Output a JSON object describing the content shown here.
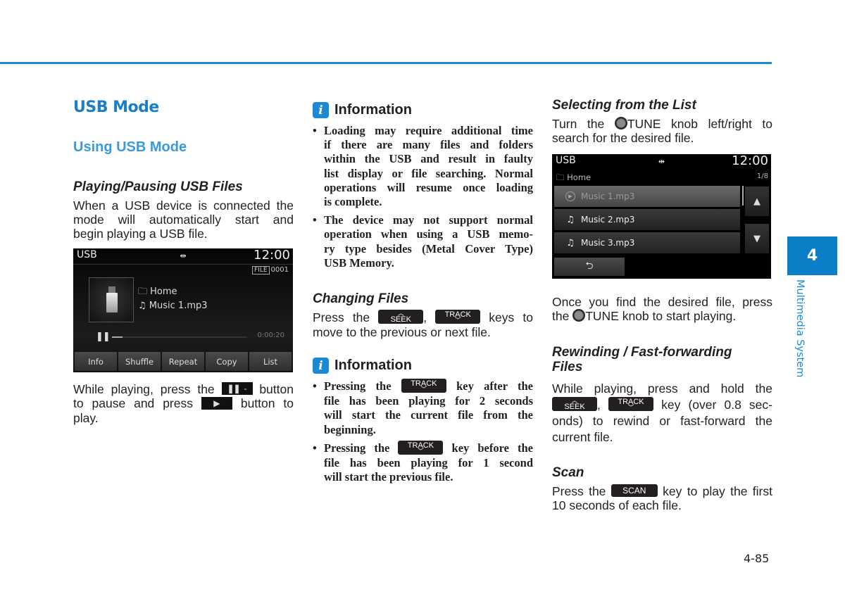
{
  "page": {
    "chapter_number": "4",
    "chapter_title": "Multimedia System",
    "page_number": "4-85",
    "accent_color": "#1a8ad4"
  },
  "col1": {
    "section_title": "USB Mode",
    "subsection_title": "Using USB Mode",
    "playing_heading": "Playing/Pausing USB Files",
    "playing_lines": [
      "When a USB device is connected the",
      "mode will automatically start and",
      "begin playing a USB file."
    ],
    "screen": {
      "source": "USB",
      "usb_icon": "usb-icon",
      "clock": "12:00",
      "file_tag": "FILE",
      "file_number": "0001",
      "folder": "Home",
      "track": "Music 1.mp3",
      "elapsed": "0:00:20",
      "progress_fraction": 0.08,
      "softkeys": [
        "Info",
        "Shuffle",
        "Repeat",
        "Copy",
        "List"
      ]
    },
    "pause_lines": {
      "l1_pre": "While playing, press the",
      "l1_post": "button",
      "l2_pre": "to pause and press",
      "l2_post": "button to",
      "l3": "play."
    }
  },
  "col2": {
    "info1": {
      "title": "Information",
      "bullets": [
        [
          "Loading may require additional time",
          "if there are many files and folders",
          "within the USB and result in faulty",
          "list display or file searching. Normal",
          "operations will resume once loading",
          "is complete."
        ],
        [
          "The device may not support normal",
          "operation when using a USB memo-",
          "ry type besides (Metal Cover Type)",
          "USB Memory."
        ]
      ]
    },
    "changing": {
      "heading": "Changing Files",
      "l1_pre": "Press the",
      "l1_post": "keys to",
      "l2": "move to the previous or next file."
    },
    "info2": {
      "title": "Information",
      "b1": {
        "pre": "Pressing the",
        "post": "key after the",
        "rest": [
          "file has been playing for 2 seconds",
          "will start the current file from the",
          "beginning."
        ]
      },
      "b2": {
        "pre": "Pressing the",
        "post": "key before the",
        "rest": [
          "file has been playing for 1 second",
          "will start the previous file."
        ]
      }
    }
  },
  "keys": {
    "seek": "SEEK",
    "track": "TRACK",
    "scan": "SCAN",
    "chev_up": "^",
    "chev_down": "v"
  },
  "col3": {
    "select_heading": "Selecting from the List",
    "select_l1_pre": "Turn the",
    "select_l1_post": "TUNE knob left/right to",
    "select_l2": "search for the desired file.",
    "screen": {
      "source": "USB",
      "clock": "12:00",
      "path": "Home",
      "count": "1/8",
      "rows": [
        "Music 1.mp3",
        "Music 2.mp3",
        "Music 3.mp3"
      ],
      "selected_index": 0
    },
    "found_l1": "Once you find the desired file, press",
    "found_l2_pre": "the",
    "found_l2_post": "TUNE knob to start playing.",
    "rewind_heading_1": "Rewinding / Fast-forwarding",
    "rewind_heading_2": "Files",
    "rewind_l1": "While playing, press and hold the",
    "rewind_l2_post": "key (over 0.8 sec-",
    "rewind_l3": "onds) to rewind or fast-forward the",
    "rewind_l4": "current file.",
    "scan_heading": "Scan",
    "scan_l1_pre": "Press the",
    "scan_l1_post": "key to play the first",
    "scan_l2": "10 seconds of each file."
  }
}
